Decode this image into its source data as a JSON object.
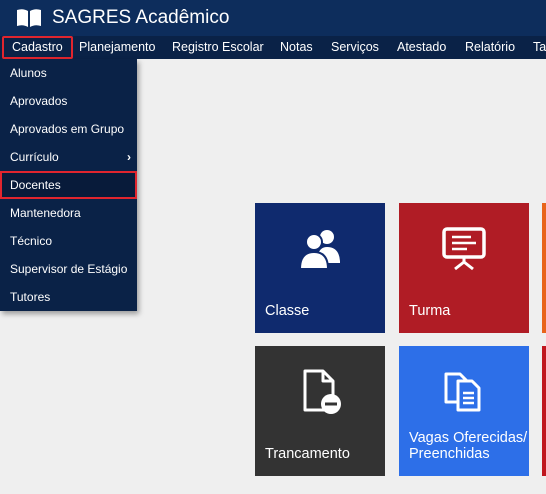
{
  "header": {
    "app_title": "SAGRES Acadêmico",
    "logo_icon": "book-icon"
  },
  "nav": {
    "items": [
      {
        "label": "Cadastro",
        "active": true
      },
      {
        "label": "Planejamento"
      },
      {
        "label": "Registro Escolar"
      },
      {
        "label": "Notas"
      },
      {
        "label": "Serviços"
      },
      {
        "label": "Atestado"
      },
      {
        "label": "Relatório"
      },
      {
        "label": "Ta"
      }
    ]
  },
  "dropdown": {
    "items": [
      {
        "label": "Alunos"
      },
      {
        "label": "Aprovados"
      },
      {
        "label": "Aprovados em Grupo"
      },
      {
        "label": "Currículo",
        "submenu": true,
        "chevron": "›"
      },
      {
        "label": "Docentes",
        "selected": true
      },
      {
        "label": "Mantenedora"
      },
      {
        "label": "Técnico"
      },
      {
        "label": "Supervisor de Estágio"
      },
      {
        "label": "Tutores"
      }
    ]
  },
  "tiles": [
    {
      "label": "Classe",
      "icon": "users-icon",
      "color": "#0f2a6e"
    },
    {
      "label": "Turma",
      "icon": "presentation-board-icon",
      "color": "#b01c25"
    },
    {
      "label": "Trancamento",
      "icon": "file-remove-icon",
      "color": "#333333"
    },
    {
      "label": "Vagas Oferecidas/ Preenchidas",
      "label_line1": "Vagas Oferecidas/",
      "label_line2": "Preenchidas",
      "icon": "documents-icon",
      "color": "#2d6fe8"
    }
  ],
  "colors": {
    "topbar": "#0d2d5c",
    "navbar": "#0a2247",
    "highlight_border": "#e0252e",
    "background": "#efefef",
    "edge_orange": "#e8641b",
    "edge_red": "#c0161e"
  }
}
